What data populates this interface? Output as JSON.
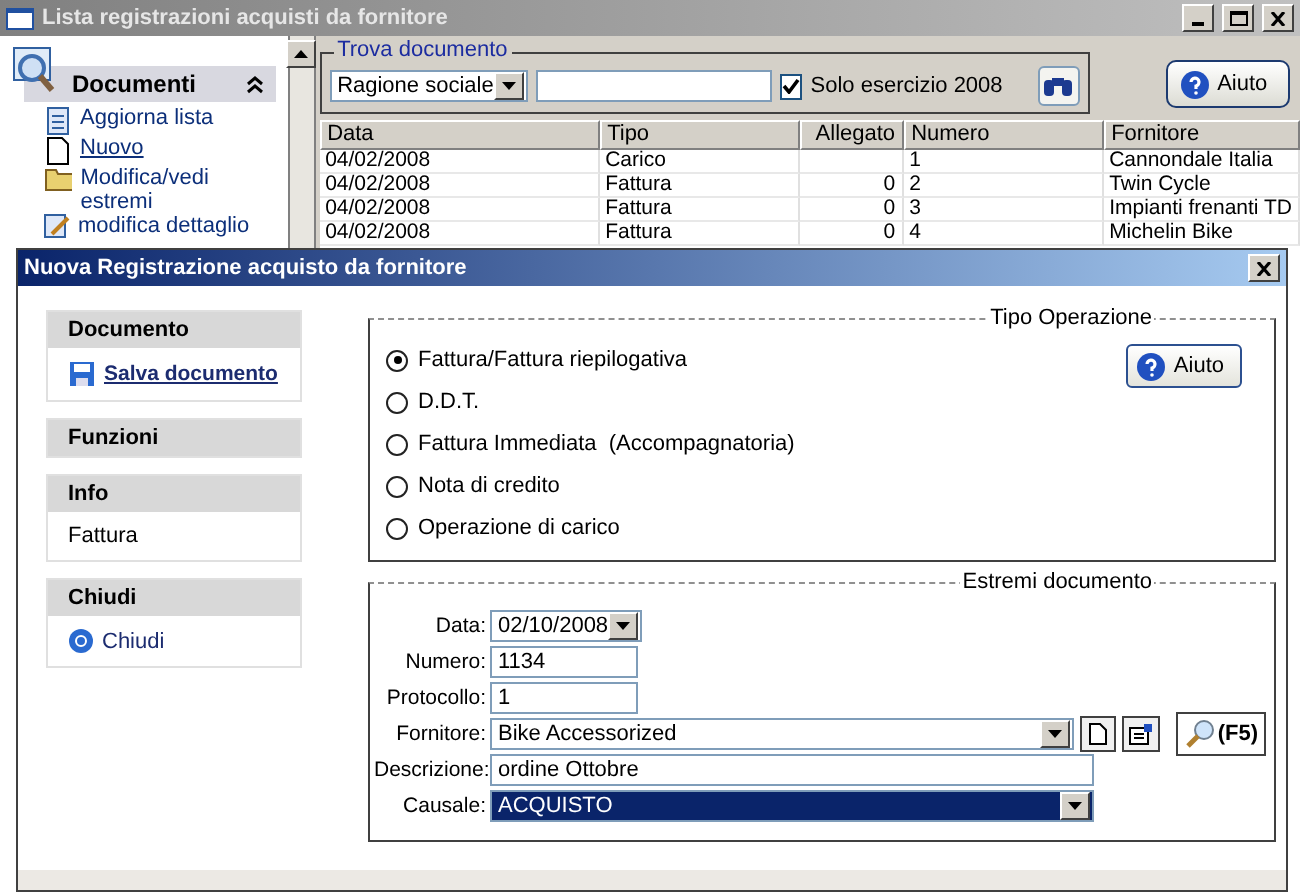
{
  "main_window": {
    "title": "Lista registrazioni acquisti da fornitore",
    "sidebar": {
      "title": "Documenti",
      "items": [
        {
          "kind": "refresh",
          "label": "Aggiorna lista",
          "hovered": false
        },
        {
          "kind": "new",
          "label": "Nuovo",
          "hovered": true
        },
        {
          "kind": "folder",
          "label": "Modifica/vedi estremi",
          "hovered": false
        },
        {
          "kind": "edit",
          "label": "modifica dettaglio",
          "hovered": false
        }
      ]
    },
    "search": {
      "title": "Trova documento",
      "field": "Ragione sociale",
      "checkbox": {
        "label": "Solo esercizio 2008",
        "checked": true
      }
    },
    "help_button": "Aiuto",
    "table": {
      "columns": [
        "Data",
        "Tipo",
        "Allegato",
        "Numero",
        "Fornitore"
      ],
      "rows": [
        [
          "04/02/2008",
          "Carico",
          "",
          "1",
          "Cannondale Italia"
        ],
        [
          "04/02/2008",
          "Fattura",
          "0",
          "2",
          "Twin Cycle"
        ],
        [
          "04/02/2008",
          "Fattura",
          "0",
          "3",
          "Impianti frenanti TD"
        ],
        [
          "04/02/2008",
          "Fattura",
          "0",
          "4",
          "Michelin Bike"
        ]
      ]
    }
  },
  "dialog": {
    "title": "Nuova Registrazione acquisto da fornitore",
    "sidebar": [
      {
        "title": "Documento",
        "items": [
          {
            "kind": "save",
            "label": "Salva documento"
          }
        ]
      },
      {
        "title": "Funzioni"
      },
      {
        "title": "Info",
        "items": [
          {
            "kind": "text",
            "label": "Fattura"
          }
        ]
      },
      {
        "title": "Chiudi",
        "items": [
          {
            "kind": "close",
            "label": "Chiudi"
          }
        ]
      }
    ],
    "operation": {
      "title": "Tipo Operazione",
      "help_button": "Aiuto",
      "options": [
        {
          "label": "Fattura/Fattura riepilogativa",
          "selected": true
        },
        {
          "label": "D.D.T.",
          "selected": false
        },
        {
          "label": "Fattura Immediata  (Accompagnatoria)",
          "selected": false
        },
        {
          "label": "Nota di credito",
          "selected": false
        },
        {
          "label": "Operazione di carico",
          "selected": false
        }
      ]
    },
    "details": {
      "title": "Estremi documento",
      "fields": [
        {
          "kind": "date",
          "label": "Data:",
          "value": "02/10/2008"
        },
        {
          "kind": "short",
          "label": "Numero:",
          "value": "1134"
        },
        {
          "kind": "short",
          "label": "Protocollo:",
          "value": "1"
        },
        {
          "kind": "lookup",
          "label": "Fornitore:",
          "value": "Bike Accessorized",
          "search": "(F5)"
        },
        {
          "kind": "wide",
          "label": "Descrizione:",
          "value": "ordine Ottobre"
        },
        {
          "kind": "select",
          "label": "Causale:",
          "value": "ACQUISTO"
        }
      ]
    }
  }
}
